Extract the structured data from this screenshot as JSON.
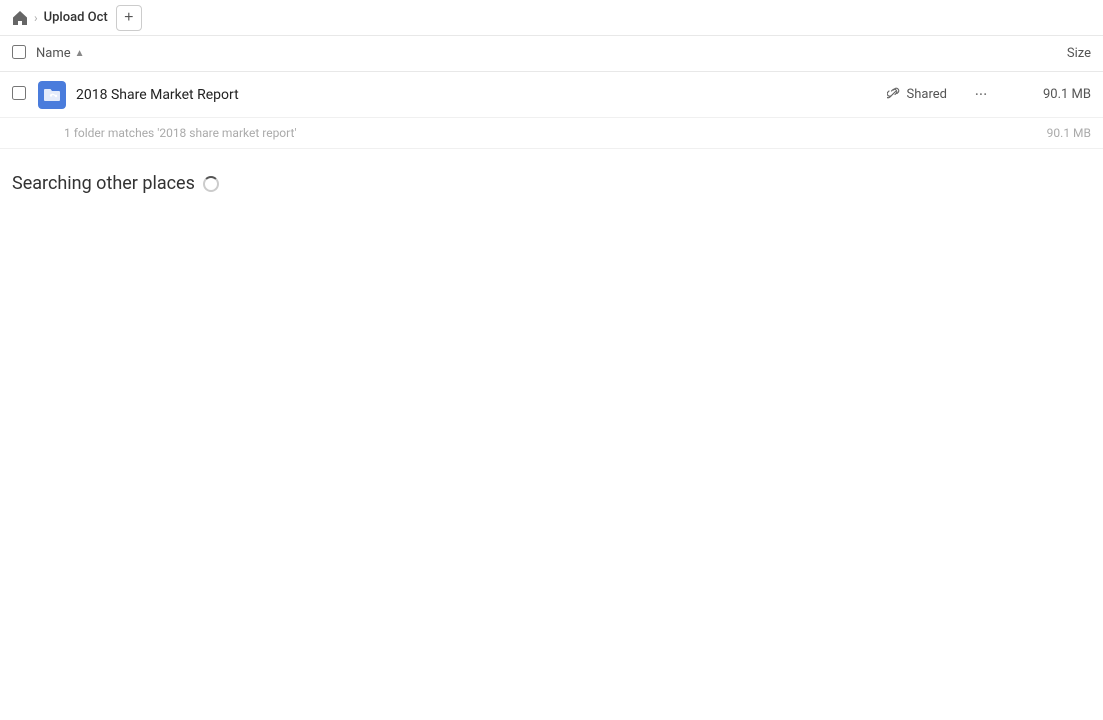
{
  "breadcrumb": {
    "home_label": "Home",
    "separator": ">",
    "current_folder": "Upload Oct",
    "add_button_label": "+"
  },
  "columns": {
    "name_label": "Name",
    "sort_arrow": "▲",
    "size_label": "Size"
  },
  "files": [
    {
      "id": 1,
      "name": "2018 Share Market Report",
      "shared_label": "Shared",
      "size": "90.1 MB",
      "icon_type": "folder-link"
    }
  ],
  "folder_matches": {
    "text": "1 folder matches '2018 share market report'",
    "size": "90.1 MB"
  },
  "searching": {
    "label": "Searching other places"
  },
  "icons": {
    "home": "⌂",
    "link": "🔗",
    "more": "···",
    "chevron_right": "›"
  }
}
